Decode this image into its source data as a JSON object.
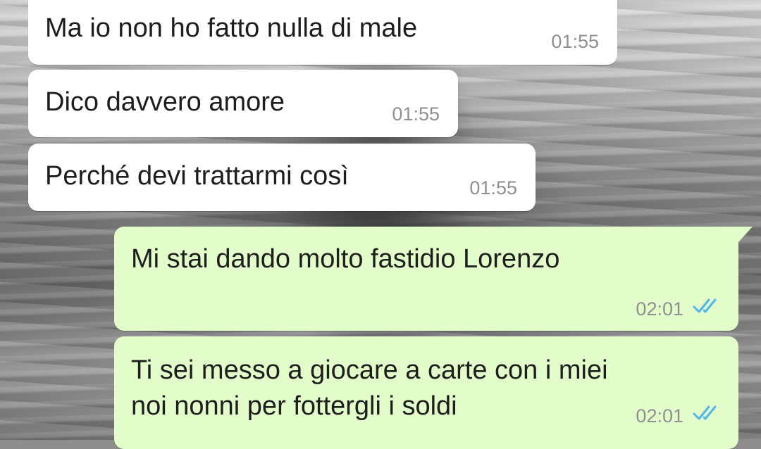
{
  "chat": {
    "messages": [
      {
        "direction": "incoming",
        "text": "Ma io non ho fatto nulla di male",
        "time": "01:55"
      },
      {
        "direction": "incoming",
        "text": "Dico davvero amore",
        "time": "01:55"
      },
      {
        "direction": "incoming",
        "text": "Perché devi trattarmi così",
        "time": "01:55"
      },
      {
        "direction": "outgoing",
        "text": "Mi stai dando molto fastidio Lorenzo",
        "time": "02:01",
        "status": "read"
      },
      {
        "direction": "outgoing",
        "lines": [
          "Ti sei messo a giocare a carte con i miei",
          "noi nonni per fottergli i soldi"
        ],
        "time": "02:01",
        "status": "read"
      }
    ]
  },
  "colors": {
    "incoming_bubble": "#ffffff",
    "outgoing_bubble": "#e2fdc9",
    "read_ticks": "#4fb6ec",
    "timestamp": "#8f8f8f"
  },
  "icons": {
    "read_receipt": "double-check-icon"
  }
}
